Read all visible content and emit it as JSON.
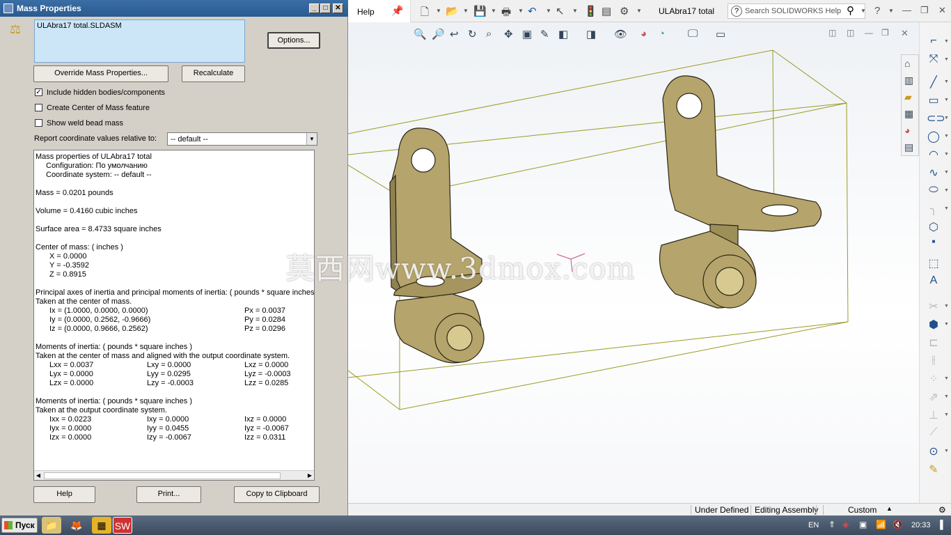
{
  "dialog": {
    "title": "Mass Properties",
    "file_item": "ULAbra17 total.SLDASM",
    "options_button": "Options...",
    "override_button": "Override Mass Properties...",
    "recalculate_button": "Recalculate",
    "check_hidden_label": "Include hidden bodies/components",
    "check_hidden_checked": true,
    "check_com_label": "Create Center of Mass feature",
    "check_com_checked": false,
    "check_weld_label": "Show weld bead mass",
    "check_weld_checked": false,
    "report_label": "Report coordinate values relative to:",
    "report_value": "-- default --",
    "help_button": "Help",
    "print_button": "Print...",
    "clipboard_button": "Copy to Clipboard",
    "results": {
      "header": "Mass properties of ULAbra17 total",
      "config": "Configuration: По умолчанию",
      "coordsys": "Coordinate system: -- default --",
      "mass": "Mass = 0.0201 pounds",
      "volume": "Volume = 0.4160 cubic inches",
      "surface": "Surface area = 8.4733 square inches",
      "com_header": "Center of mass: ( inches )",
      "com_x": "X = 0.0000",
      "com_y": "Y = -0.3592",
      "com_z": "Z = 0.8915",
      "pa_header": "Principal axes of inertia and principal moments of inertia: ( pounds * square inches )",
      "pa_taken": "Taken at the center of mass.",
      "pa_rows": [
        {
          "axis": "Ix = (1.0000, 0.0000, 0.0000)",
          "moment": "Px = 0.0037"
        },
        {
          "axis": "Iy = (0.0000, 0.2562, -0.9666)",
          "moment": "Py = 0.0284"
        },
        {
          "axis": "Iz = (0.0000, 0.9666, 0.2562)",
          "moment": "Pz = 0.0296"
        }
      ],
      "mi1_header": "Moments of inertia: ( pounds * square inches )",
      "mi1_taken": "Taken at the center of mass and aligned with the output coordinate system.",
      "mi1_rows": [
        [
          "Lxx = 0.0037",
          "Lxy = 0.0000",
          "Lxz = 0.0000"
        ],
        [
          "Lyx = 0.0000",
          "Lyy = 0.0295",
          "Lyz = -0.0003"
        ],
        [
          "Lzx = 0.0000",
          "Lzy = -0.0003",
          "Lzz = 0.0285"
        ]
      ],
      "mi2_header": "Moments of inertia: ( pounds * square inches )",
      "mi2_taken": "Taken at the output coordinate system.",
      "mi2_rows": [
        [
          "Ixx = 0.0223",
          "Ixy = 0.0000",
          "Ixz = 0.0000"
        ],
        [
          "Iyx = 0.0000",
          "Iyy = 0.0455",
          "Iyz = -0.0067"
        ],
        [
          "Izx = 0.0000",
          "Izy = -0.0067",
          "Izz = 0.0311"
        ]
      ]
    }
  },
  "solidworks": {
    "help_tab": "Help",
    "doc_title": "ULAbra17 total",
    "search_placeholder": "Search SOLIDWORKS Help",
    "status": {
      "state": "Under Defined",
      "mode": "Editing Assembly",
      "units": "Custom"
    },
    "colors": {
      "part_fill": "#b5a46b",
      "bbox_line": "#9a9a20"
    }
  },
  "watermark": "莫西网www.3dmox.com",
  "taskbar": {
    "start_label": "Пуск",
    "language": "EN",
    "clock": "20:33"
  }
}
